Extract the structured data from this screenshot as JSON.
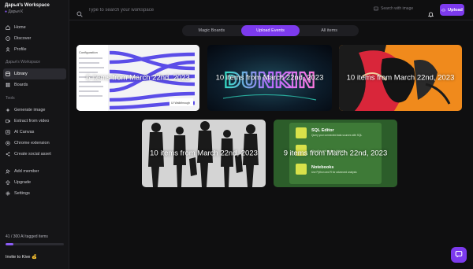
{
  "workspace": {
    "name": "Дарья's Workspace",
    "user": "Дарья К"
  },
  "nav_top": [
    {
      "label": "Home",
      "icon": "home-icon"
    },
    {
      "label": "Discover",
      "icon": "compass-icon"
    },
    {
      "label": "Profile",
      "icon": "user-icon"
    }
  ],
  "sections": {
    "workspace": "Дарья's Workspace",
    "tools": "Tools"
  },
  "nav_workspace": [
    {
      "label": "Library",
      "icon": "library-icon",
      "active": true
    },
    {
      "label": "Boards",
      "icon": "boards-icon"
    }
  ],
  "nav_tools": [
    {
      "label": "Generate image",
      "icon": "sparkle-icon"
    },
    {
      "label": "Extract from video",
      "icon": "video-icon"
    },
    {
      "label": "AI Canvas",
      "icon": "canvas-icon"
    },
    {
      "label": "Chrome extension",
      "icon": "chrome-icon"
    },
    {
      "label": "Create social asset",
      "icon": "share-icon"
    }
  ],
  "nav_bottom": [
    {
      "label": "Add member",
      "icon": "add-user-icon"
    },
    {
      "label": "Upgrade",
      "icon": "upgrade-icon"
    },
    {
      "label": "Settings",
      "icon": "gear-icon"
    }
  ],
  "usage": {
    "text": "41 / 300 AI tagged items",
    "fraction": 0.137
  },
  "invite": {
    "label": "Invite to Kive 💰"
  },
  "search": {
    "placeholder": "Type to search your workspace",
    "image_search": "Search with image"
  },
  "upload": {
    "label": "Upload"
  },
  "tabs": [
    {
      "label": "Magic Boards",
      "active": false
    },
    {
      "label": "Upload Events",
      "active": true
    },
    {
      "label": "All items",
      "active": false
    }
  ],
  "cards": [
    {
      "caption": "6 items from March 22nd, 2023"
    },
    {
      "caption": "10 items from March 22nd, 2023"
    },
    {
      "caption": "10 items from March 22nd, 2023"
    },
    {
      "caption": "10 items from March 22nd, 2023"
    },
    {
      "caption": "9 items from March 22nd, 2023"
    }
  ],
  "card_art_text": {
    "card1": [
      "Configuration",
      "UI Walkthrough"
    ],
    "card2": "DUNKIN",
    "card5": [
      "SQL Editor",
      "Query your connected data sources with SQL",
      "Visualize and explore datasets",
      "Notebooks",
      "Use Python and R for advanced analysis"
    ]
  },
  "colors": {
    "accent": "#7c3aed",
    "background": "#0f0f10",
    "sidebar": "#151517"
  }
}
